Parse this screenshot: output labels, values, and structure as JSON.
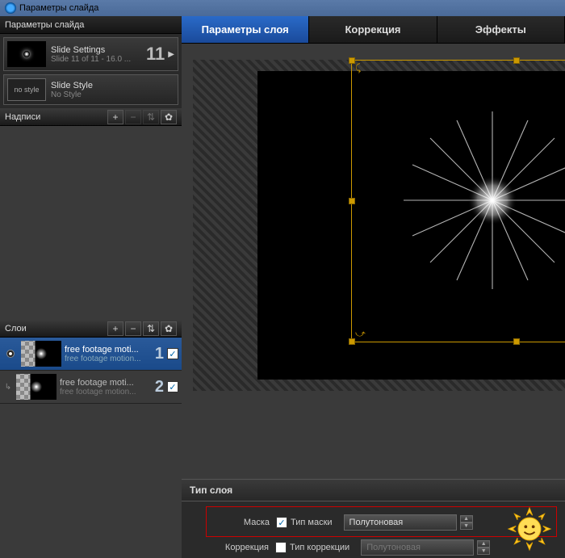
{
  "titlebar": {
    "text": "Параметры слайда"
  },
  "sidebar": {
    "header": "Параметры слайда",
    "slide_settings": {
      "title": "Slide Settings",
      "sub": "Slide 11 of 11 - 16.0 ...",
      "num": "11"
    },
    "slide_style": {
      "badge": "no style",
      "title": "Slide Style",
      "sub": "No Style"
    },
    "captions_header": "Надписи",
    "layers_header": "Слои",
    "layers": [
      {
        "title": "free footage moti...",
        "sub": "free footage motion...",
        "num": "1",
        "checked": true,
        "selected": true
      },
      {
        "title": "free footage moti...",
        "sub": "free footage motion...",
        "num": "2",
        "checked": true,
        "selected": false
      }
    ]
  },
  "tabs": {
    "t1": "Параметры слоя",
    "t2": "Коррекция",
    "t3": "Эффекты"
  },
  "bottom": {
    "title": "Тип слоя",
    "mask_label": "Маска",
    "mask_type_label": "Тип маски",
    "mask_type_value": "Полутоновая",
    "corr_label": "Коррекция",
    "corr_type_label": "Тип коррекции",
    "corr_type_value": "Полутоновая"
  }
}
